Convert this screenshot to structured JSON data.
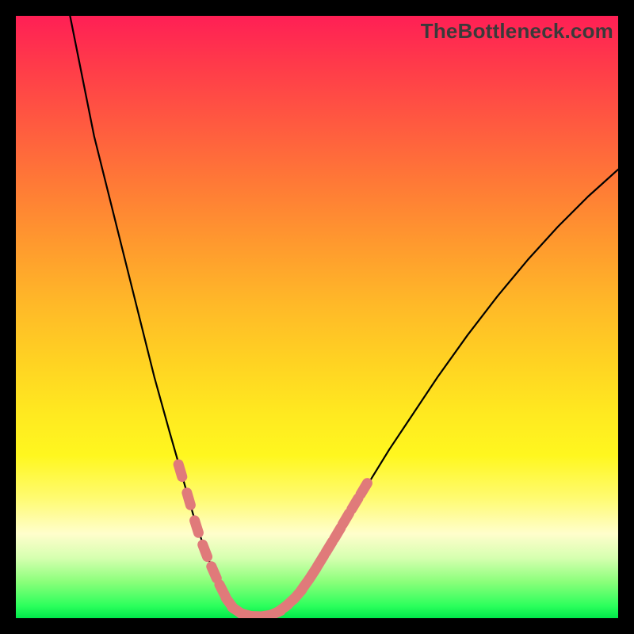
{
  "watermark": "TheBottleneck.com",
  "colors": {
    "frame": "#000000",
    "curve": "#000000",
    "marker_fill": "#e07a7a",
    "marker_stroke": "#c85a5a"
  },
  "chart_data": {
    "type": "line",
    "title": "",
    "xlabel": "",
    "ylabel": "",
    "xlim": [
      0,
      100
    ],
    "ylim": [
      0,
      100
    ],
    "grid": false,
    "legend": false,
    "curve_points": [
      {
        "x": 9.0,
        "y": 100.0
      },
      {
        "x": 11.0,
        "y": 90.0
      },
      {
        "x": 13.0,
        "y": 80.0
      },
      {
        "x": 15.5,
        "y": 70.0
      },
      {
        "x": 18.0,
        "y": 60.0
      },
      {
        "x": 20.5,
        "y": 50.0
      },
      {
        "x": 23.0,
        "y": 40.0
      },
      {
        "x": 25.5,
        "y": 31.0
      },
      {
        "x": 27.5,
        "y": 24.0
      },
      {
        "x": 29.5,
        "y": 17.0
      },
      {
        "x": 31.5,
        "y": 11.0
      },
      {
        "x": 33.5,
        "y": 6.0
      },
      {
        "x": 35.0,
        "y": 3.0
      },
      {
        "x": 37.0,
        "y": 1.0
      },
      {
        "x": 39.0,
        "y": 0.3
      },
      {
        "x": 41.0,
        "y": 0.3
      },
      {
        "x": 43.0,
        "y": 0.7
      },
      {
        "x": 45.0,
        "y": 2.0
      },
      {
        "x": 47.0,
        "y": 4.0
      },
      {
        "x": 49.0,
        "y": 7.0
      },
      {
        "x": 52.0,
        "y": 11.5
      },
      {
        "x": 55.0,
        "y": 16.5
      },
      {
        "x": 58.0,
        "y": 21.5
      },
      {
        "x": 62.0,
        "y": 28.0
      },
      {
        "x": 66.0,
        "y": 34.0
      },
      {
        "x": 70.0,
        "y": 40.0
      },
      {
        "x": 75.0,
        "y": 47.0
      },
      {
        "x": 80.0,
        "y": 53.5
      },
      {
        "x": 85.0,
        "y": 59.5
      },
      {
        "x": 90.0,
        "y": 65.0
      },
      {
        "x": 95.0,
        "y": 70.0
      },
      {
        "x": 100.0,
        "y": 74.5
      }
    ],
    "marker_points": [
      {
        "x": 27.3,
        "y": 24.5
      },
      {
        "x": 28.7,
        "y": 19.8
      },
      {
        "x": 30.0,
        "y": 15.2
      },
      {
        "x": 31.4,
        "y": 11.2
      },
      {
        "x": 32.9,
        "y": 7.6
      },
      {
        "x": 34.3,
        "y": 4.6
      },
      {
        "x": 35.5,
        "y": 2.5
      },
      {
        "x": 36.8,
        "y": 1.2
      },
      {
        "x": 38.4,
        "y": 0.5
      },
      {
        "x": 40.0,
        "y": 0.3
      },
      {
        "x": 41.6,
        "y": 0.4
      },
      {
        "x": 43.0,
        "y": 0.8
      },
      {
        "x": 44.3,
        "y": 1.6
      },
      {
        "x": 45.5,
        "y": 2.6
      },
      {
        "x": 46.8,
        "y": 3.9
      },
      {
        "x": 48.0,
        "y": 5.5
      },
      {
        "x": 49.3,
        "y": 7.4
      },
      {
        "x": 50.6,
        "y": 9.5
      },
      {
        "x": 52.0,
        "y": 11.8
      },
      {
        "x": 53.4,
        "y": 14.1
      },
      {
        "x": 54.8,
        "y": 16.5
      },
      {
        "x": 56.3,
        "y": 19.0
      },
      {
        "x": 57.8,
        "y": 21.5
      }
    ],
    "marker_radius": 6.5
  }
}
